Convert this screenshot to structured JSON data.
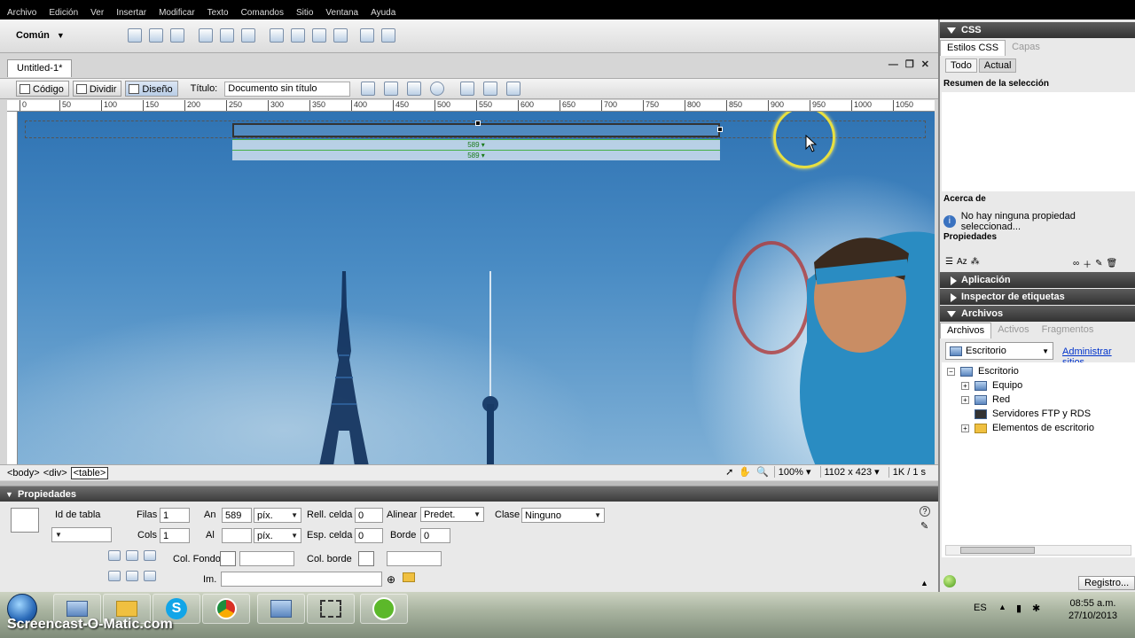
{
  "menu": [
    "Archivo",
    "Edición",
    "Ver",
    "Insertar",
    "Modificar",
    "Texto",
    "Comandos",
    "Sitio",
    "Ventana",
    "Ayuda"
  ],
  "insert_bar": {
    "category": "Común"
  },
  "document": {
    "tab_title": "Untitled-1*",
    "view_code": "Código",
    "view_split": "Dividir",
    "view_design": "Diseño",
    "title_label": "Título:",
    "title_value": "Documento sin título"
  },
  "ruler": [
    "0",
    "50",
    "100",
    "150",
    "200",
    "250",
    "300",
    "350",
    "400",
    "450",
    "500",
    "550",
    "600",
    "650",
    "700",
    "750",
    "800",
    "850",
    "900",
    "950",
    "1000",
    "1050"
  ],
  "table_width_label": "589",
  "status": {
    "tags": [
      "<body>",
      "<div>",
      "<table>"
    ],
    "zoom": "100%",
    "size": "1102 x 423",
    "download": "1K / 1 s"
  },
  "properties": {
    "header": "Propiedades",
    "table_id_label": "Id de tabla",
    "rows_label": "Filas",
    "rows_value": "1",
    "cols_label": "Cols",
    "cols_value": "1",
    "width_label": "An",
    "width_value": "589",
    "width_unit": "píx.",
    "height_label": "Al",
    "height_value": "",
    "height_unit": "píx.",
    "cellpad_label": "Rell. celda",
    "cellpad_value": "0",
    "cellspace_label": "Esp. celda",
    "cellspace_value": "0",
    "align_label": "Alinear",
    "align_value": "Predet.",
    "border_label": "Borde",
    "border_value": "0",
    "class_label": "Clase",
    "class_value": "Ninguno",
    "bgcolor_label": "Col. Fondo",
    "bordercolor_label": "Col. borde",
    "image_label": "Im."
  },
  "css_panel": {
    "header": "CSS",
    "tab_styles": "Estilos CSS",
    "tab_layers": "Capas",
    "btn_all": "Todo",
    "btn_current": "Actual",
    "summary_title": "Resumen de la selección",
    "about_title": "Acerca de",
    "about_text": "No hay ninguna propiedad seleccionad...",
    "properties_title": "Propiedades"
  },
  "panels": {
    "application": "Aplicación",
    "tag_inspector": "Inspector de etiquetas",
    "files": "Archivos"
  },
  "files_panel": {
    "tab_files": "Archivos",
    "tab_assets": "Activos",
    "tab_snippets": "Fragmentos",
    "location": "Escritorio",
    "manage_sites": "Administrar sitios",
    "tree": [
      "Escritorio",
      "Equipo",
      "Red",
      "Servidores FTP y RDS",
      "Elementos de escritorio"
    ],
    "log_button": "Registro..."
  },
  "taskbar": {
    "watermark": "Screencast-O-Matic.com",
    "lang": "ES",
    "time": "08:55 a.m.",
    "date": "27/10/2013"
  },
  "colors": {
    "accent": "#2f73b3",
    "selection_ring": "#e8e040",
    "table_guide": "#46b046"
  }
}
